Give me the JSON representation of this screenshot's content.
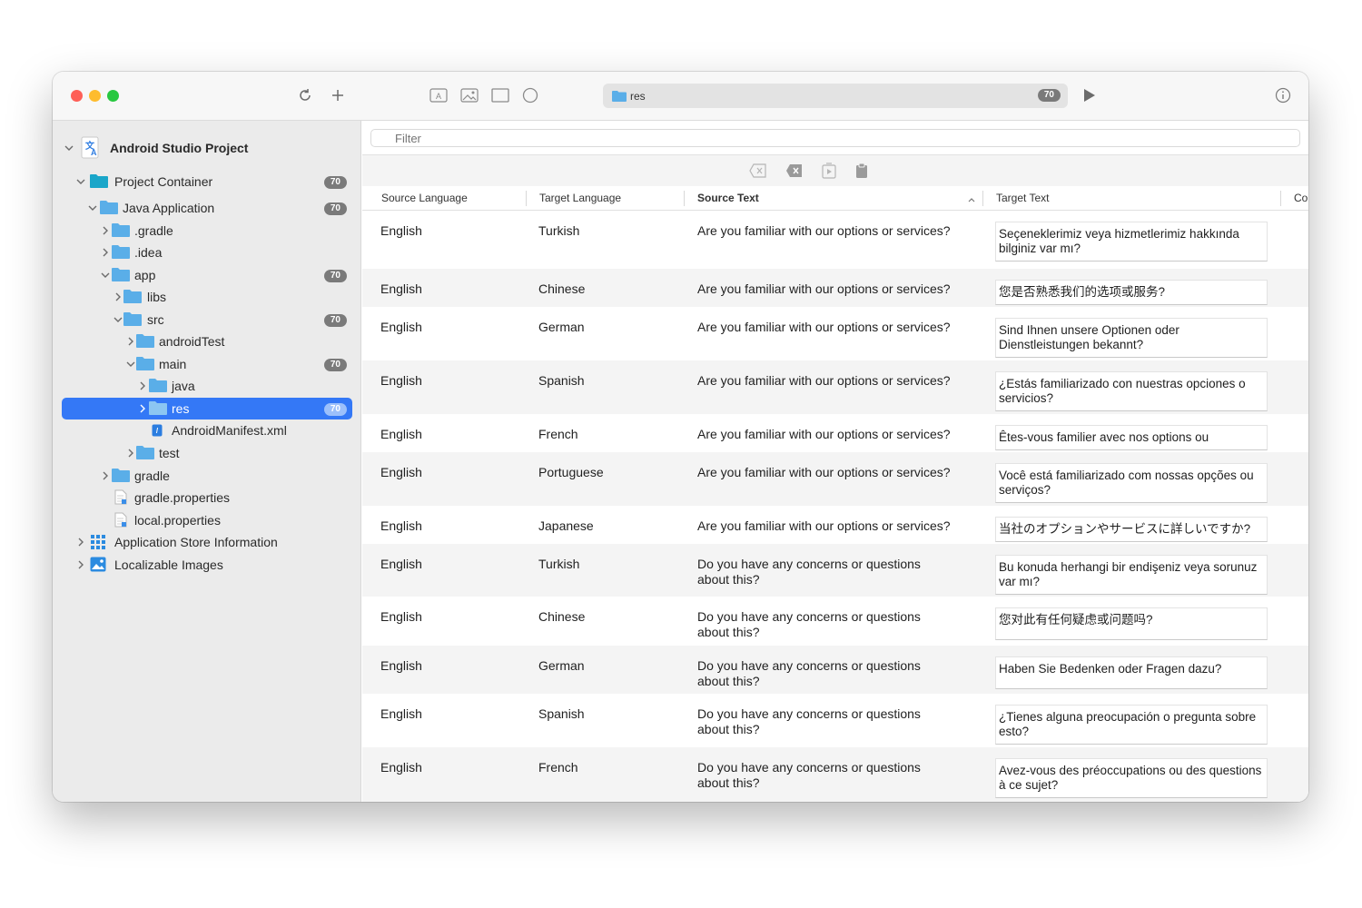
{
  "toolbar": {
    "path_label": "res",
    "path_count": "70"
  },
  "sidebar": {
    "project_title": "Android Studio Project",
    "items": [
      {
        "label": "Project Container",
        "badge": "70"
      },
      {
        "label": "Java Application",
        "badge": "70"
      },
      {
        "label": ".gradle"
      },
      {
        "label": ".idea"
      },
      {
        "label": "app",
        "badge": "70"
      },
      {
        "label": "libs"
      },
      {
        "label": "src",
        "badge": "70"
      },
      {
        "label": "androidTest"
      },
      {
        "label": "main",
        "badge": "70"
      },
      {
        "label": "java"
      },
      {
        "label": "res",
        "badge": "70"
      },
      {
        "label": "AndroidManifest.xml"
      },
      {
        "label": "test"
      },
      {
        "label": "gradle"
      },
      {
        "label": "gradle.properties"
      },
      {
        "label": "local.properties"
      },
      {
        "label": "Application Store Information"
      },
      {
        "label": "Localizable Images"
      }
    ]
  },
  "filter": {
    "placeholder": "Filter"
  },
  "table": {
    "headers": [
      "Source Language",
      "Target Language",
      "Source Text",
      "Target Text",
      "Co"
    ],
    "rows": [
      {
        "source_language": "English",
        "target_language": "Turkish",
        "source_text": "Are you familiar with our options or services?",
        "target_text": "Seçeneklerimiz veya hizmetlerimiz hakkında bilginiz var mı?"
      },
      {
        "source_language": "English",
        "target_language": "Chinese",
        "source_text": "Are you familiar with our options or services?",
        "target_text": "您是否熟悉我们的选项或服务?"
      },
      {
        "source_language": "English",
        "target_language": "German",
        "source_text": "Are you familiar with our options or services?",
        "target_text": "Sind Ihnen unsere Optionen oder Dienstleistungen bekannt?"
      },
      {
        "source_language": "English",
        "target_language": "Spanish",
        "source_text": "Are you familiar with our options or services?",
        "target_text": "¿Estás familiarizado con nuestras opciones o servicios?"
      },
      {
        "source_language": "English",
        "target_language": "French",
        "source_text": "Are you familiar with our options or services?",
        "target_text": "Êtes-vous familier avec nos options ou"
      },
      {
        "source_language": "English",
        "target_language": "Portuguese",
        "source_text": "Are you familiar with our options or services?",
        "target_text": "Você está familiarizado com nossas opções ou serviços?"
      },
      {
        "source_language": "English",
        "target_language": "Japanese",
        "source_text": "Are you familiar with our options or services?",
        "target_text": "当社のオプションやサービスに詳しいですか?"
      },
      {
        "source_language": "English",
        "target_language": "Turkish",
        "source_text": "Do you have any concerns or questions about this?",
        "target_text": "Bu konuda herhangi bir endişeniz veya sorunuz var mı?"
      },
      {
        "source_language": "English",
        "target_language": "Chinese",
        "source_text": "Do you have any concerns or questions about this?",
        "target_text": "您对此有任何疑虑或问题吗?"
      },
      {
        "source_language": "English",
        "target_language": "German",
        "source_text": "Do you have any concerns or questions about this?",
        "target_text": "Haben Sie Bedenken oder Fragen dazu?"
      },
      {
        "source_language": "English",
        "target_language": "Spanish",
        "source_text": "Do you have any concerns or questions about this?",
        "target_text": "¿Tienes alguna preocupación o pregunta sobre esto?"
      },
      {
        "source_language": "English",
        "target_language": "French",
        "source_text": "Do you have any concerns or questions about this?",
        "target_text": "Avez-vous des préoccupations ou des questions à ce sujet?"
      }
    ]
  },
  "colors": {
    "selection": "#3478f6",
    "folder": "#5aaee8",
    "badge": "#7a7a7a"
  }
}
